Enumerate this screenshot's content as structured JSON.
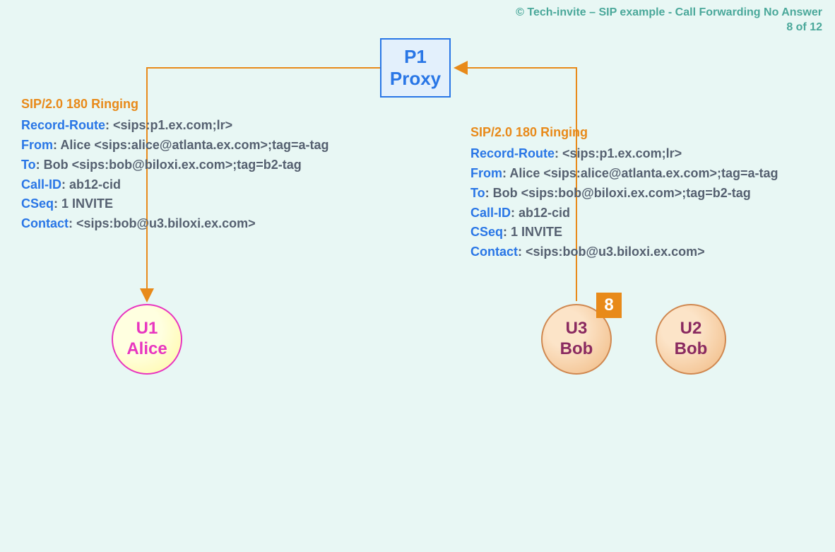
{
  "meta": {
    "copyright_line1": "© Tech-invite – SIP example - Call Forwarding No Answer",
    "copyright_line2": "8 of 12"
  },
  "proxy": {
    "line1": "P1",
    "line2": "Proxy"
  },
  "nodes": {
    "alice": {
      "line1": "U1",
      "line2": "Alice"
    },
    "u3": {
      "line1": "U3",
      "line2": "Bob"
    },
    "u2": {
      "line1": "U2",
      "line2": "Bob"
    }
  },
  "step_badge": "8",
  "msg_left": {
    "status": "SIP/2.0 180 Ringing",
    "record_route_label": "Record-Route",
    "record_route_val": ": <sips:p1.ex.com;lr>",
    "from_label": "From",
    "from_val": ": Alice <sips:alice@atlanta.ex.com>;tag=a-tag",
    "to_label": "To",
    "to_val": ": Bob <sips:bob@biloxi.ex.com>;tag=b2-tag",
    "callid_label": "Call-ID",
    "callid_val": ": ab12-cid",
    "cseq_label": "CSeq",
    "cseq_val": ": 1 INVITE",
    "contact_label": "Contact",
    "contact_val": ": <sips:bob@u3.biloxi.ex.com>"
  },
  "msg_right": {
    "status": "SIP/2.0 180 Ringing",
    "record_route_label": "Record-Route",
    "record_route_val": ": <sips:p1.ex.com;lr>",
    "from_label": "From",
    "from_val": ": Alice <sips:alice@atlanta.ex.com>;tag=a-tag",
    "to_label": "To",
    "to_val": ": Bob <sips:bob@biloxi.ex.com>;tag=b2-tag",
    "callid_label": "Call-ID",
    "callid_val": ": ab12-cid",
    "cseq_label": "CSeq",
    "cseq_val": ": 1 INVITE",
    "contact_label": "Contact",
    "contact_val": ": <sips:bob@u3.biloxi.ex.com>"
  }
}
